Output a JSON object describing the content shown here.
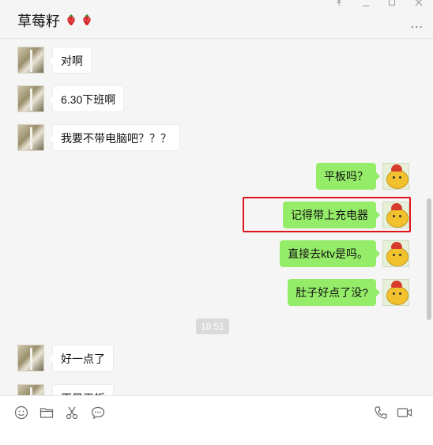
{
  "header": {
    "contact_name": "草莓籽",
    "berry_icons": [
      "strawberry-icon",
      "strawberry-icon"
    ],
    "window_controls": [
      "pin-icon",
      "minimize-icon",
      "maximize-icon",
      "close-icon"
    ],
    "more_label": "..."
  },
  "messages": [
    {
      "side": "in",
      "text": "对啊"
    },
    {
      "side": "in",
      "text": "6.30下班啊"
    },
    {
      "side": "in",
      "text": "我要不带电脑吧？？？"
    },
    {
      "side": "out",
      "text": "平板吗？"
    },
    {
      "side": "out",
      "text": "记得带上充电器"
    },
    {
      "side": "out",
      "text": "直接去ktv是吗。"
    },
    {
      "side": "out",
      "text": "肚子好点了没?"
    },
    {
      "side": "in",
      "text": "好一点了"
    },
    {
      "side": "in",
      "text": "不是平板"
    }
  ],
  "timestamp": "18:51",
  "toolbar": {
    "left_icons": [
      "emoji-icon",
      "folder-icon",
      "scissors-icon",
      "chat-bubble-icon"
    ],
    "right_icons": [
      "phone-icon",
      "video-call-icon"
    ]
  },
  "colors": {
    "outgoing_bubble": "#95ec69",
    "incoming_bubble": "#ffffff",
    "highlight_border": "#e0151a",
    "chat_background": "#f5f5f5"
  }
}
